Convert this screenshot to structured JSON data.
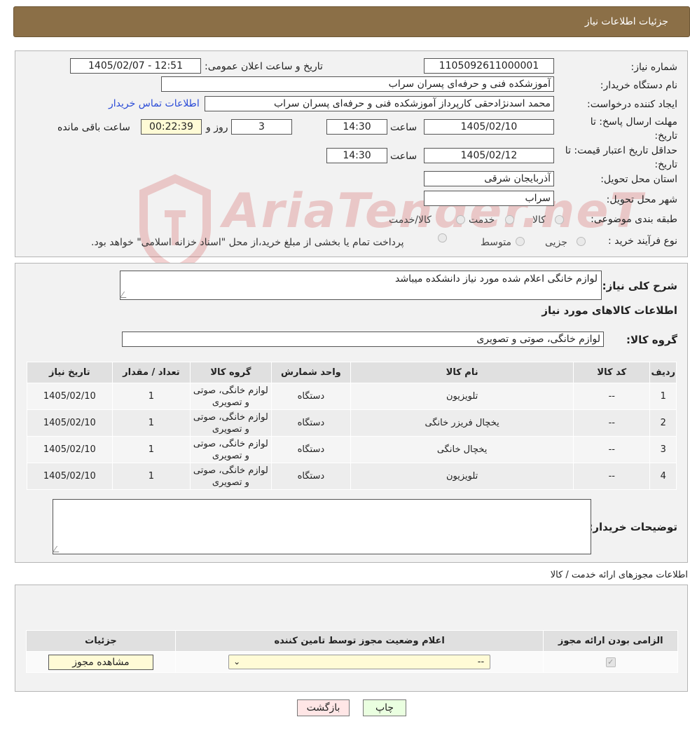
{
  "header": {
    "title": "جزئیات اطلاعات نیاز"
  },
  "form": {
    "need_number_label": "شماره نیاز:",
    "need_number": "1105092611000001",
    "announce_label": "تاریخ و ساعت اعلان عمومی:",
    "announce_value": "1405/02/07 - 12:51",
    "buyer_org_label": "نام دستگاه خریدار:",
    "buyer_org": "آموزشکده فنی و حرفه‌ای پسران سراب",
    "creator_label": "ایجاد کننده درخواست:",
    "creator": "محمد اسدنژادحقی کارپرداز آموزشکده فنی و حرفه‌ای پسران سراب",
    "contact_link": "اطلاعات تماس خریدار",
    "deadline_label": "مهلت ارسال پاسخ: تا تاریخ:",
    "deadline_date": "1405/02/10",
    "time_label": "ساعت",
    "deadline_time": "14:30",
    "days_value": "3",
    "days_label": "روز و",
    "remaining_time": "00:22:39",
    "remaining_label": "ساعت باقی مانده",
    "validity_label": "حداقل تاریخ اعتبار قیمت: تا تاریخ:",
    "validity_date": "1405/02/12",
    "validity_time": "14:30",
    "province_label": "استان محل تحویل:",
    "province": "آذربایجان شرقی",
    "city_label": "شهر محل تحویل:",
    "city": "سراب",
    "category_label": "طبقه بندی موضوعی:",
    "category_options": [
      "کالا",
      "خدمت",
      "کالا/خدمت"
    ],
    "process_label": "نوع فرآیند خرید :",
    "process_options": [
      "جزیی",
      "متوسط"
    ],
    "process_note": "پرداخت تمام یا بخشی از مبلغ خرید،از محل \"اسناد خزانه اسلامی\" خواهد بود."
  },
  "summary": {
    "desc_label": "شرح کلی نیاز:",
    "desc_value": "لوازم خانگی اعلام شده مورد نیاز دانشکده میباشد",
    "goods_info_title": "اطلاعات کالاهای مورد نیاز",
    "goods_group_label": "گروه کالا:",
    "goods_group_value": "لوازم خانگی، صوتی و تصویری",
    "buyer_notes_label": "توضیحات خریدار:"
  },
  "items_table": {
    "headers": [
      "ردیف",
      "کد کالا",
      "نام کالا",
      "واحد شمارش",
      "گروه کالا",
      "تعداد / مقدار",
      "تاریخ نیاز"
    ],
    "rows": [
      [
        "1",
        "--",
        "تلویزیون",
        "دستگاه",
        "لوازم خانگی، صوتی و تصویری",
        "1",
        "1405/02/10"
      ],
      [
        "2",
        "--",
        "یخچال فریزر خانگی",
        "دستگاه",
        "لوازم خانگی، صوتی و تصویری",
        "1",
        "1405/02/10"
      ],
      [
        "3",
        "--",
        "یخچال خانگی",
        "دستگاه",
        "لوازم خانگی، صوتی و تصویری",
        "1",
        "1405/02/10"
      ],
      [
        "4",
        "--",
        "تلویزیون",
        "دستگاه",
        "لوازم خانگی، صوتی و تصویری",
        "1",
        "1405/02/10"
      ]
    ]
  },
  "permits": {
    "title": "اطلاعات مجوزهای ارائه خدمت / کالا",
    "headers": [
      "الزامی بودن ارائه مجوز",
      "اعلام وضعیت مجوز توسط تامین کننده",
      "جزئیات"
    ],
    "select_value": "--",
    "view_button": "مشاهده مجوز"
  },
  "buttons": {
    "print": "چاپ",
    "back": "بازگشت"
  },
  "watermark": {
    "text": "AriaTender.neT"
  }
}
